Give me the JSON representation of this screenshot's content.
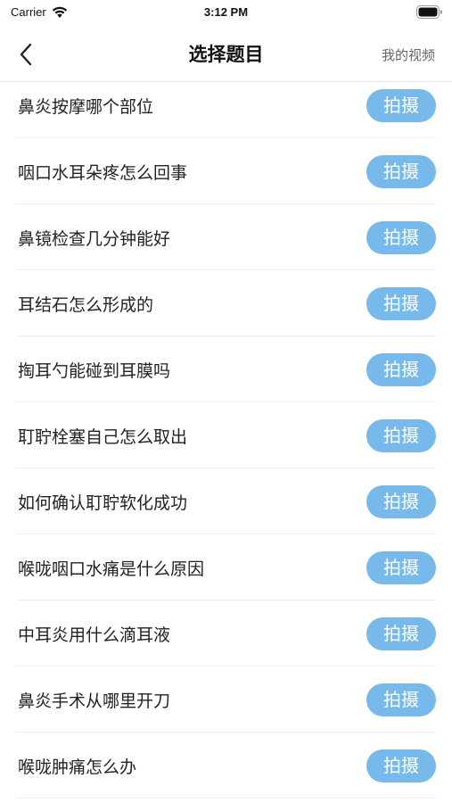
{
  "status_bar": {
    "carrier": "Carrier",
    "time": "3:12 PM"
  },
  "nav": {
    "title": "选择题目",
    "right_link": "我的视频",
    "back_icon": "chevron-left-icon"
  },
  "colors": {
    "button_bg": "#76b9ea",
    "button_text": "#ffffff"
  },
  "topics": [
    {
      "label": "鼻炎按摩哪个部位",
      "action": "拍摄"
    },
    {
      "label": "咽口水耳朵疼怎么回事",
      "action": "拍摄"
    },
    {
      "label": "鼻镜检查几分钟能好",
      "action": "拍摄"
    },
    {
      "label": "耳结石怎么形成的",
      "action": "拍摄"
    },
    {
      "label": "掏耳勺能碰到耳膜吗",
      "action": "拍摄"
    },
    {
      "label": "耵聍栓塞自己怎么取出",
      "action": "拍摄"
    },
    {
      "label": "如何确认耵聍软化成功",
      "action": "拍摄"
    },
    {
      "label": "喉咙咽口水痛是什么原因",
      "action": "拍摄"
    },
    {
      "label": "中耳炎用什么滴耳液",
      "action": "拍摄"
    },
    {
      "label": "鼻炎手术从哪里开刀",
      "action": "拍摄"
    },
    {
      "label": "喉咙肿痛怎么办",
      "action": "拍摄"
    }
  ]
}
